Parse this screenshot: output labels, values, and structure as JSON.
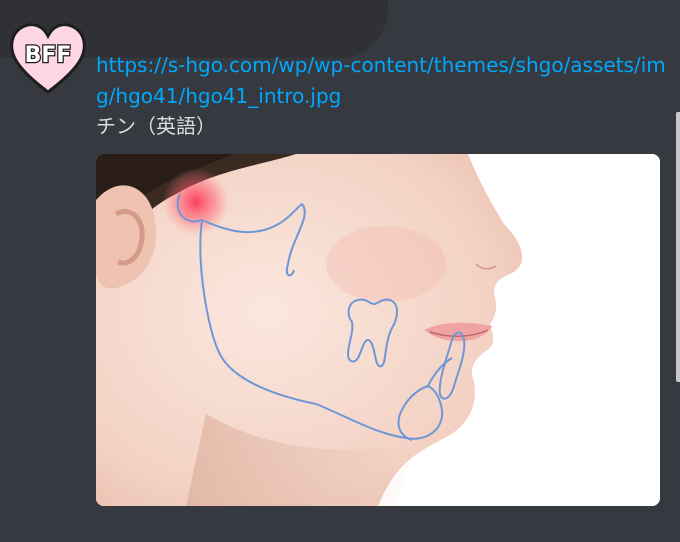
{
  "avatar": {
    "label": "BFF",
    "icon": "heart-avatar-icon"
  },
  "message": {
    "link": "https://s-hgo.com/wp/wp-content/themes/shgo/assets/img/hgo41/hgo41_intro.jpg",
    "text": "チン（英語）"
  },
  "image": {
    "icon": "jaw-illustration-image"
  },
  "colors": {
    "background": "#36393f",
    "link": "#00a8fc",
    "text": "#dcddde",
    "outline": "#6f97d6",
    "highlight": "#ff4d6a"
  }
}
